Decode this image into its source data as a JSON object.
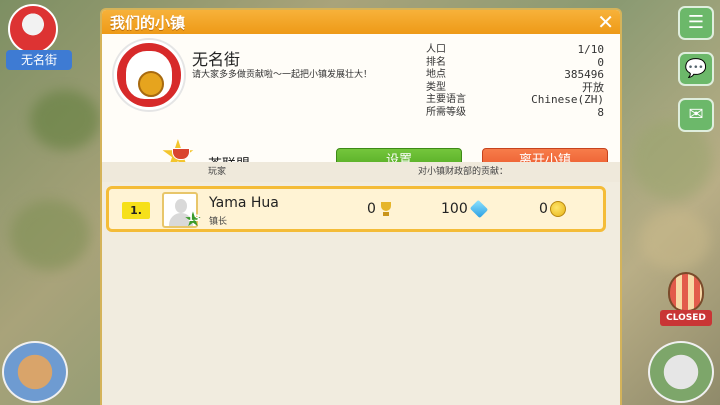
{
  "background": {
    "town_badge_label": "无名街"
  },
  "modal": {
    "title": "我们的小镇",
    "close_label": "✕"
  },
  "town": {
    "name": "无名街",
    "description": "请大家多多做贡献啦～一起把小镇发展壮大！",
    "stats": [
      {
        "label": "人口",
        "value": "1/10"
      },
      {
        "label": "排名",
        "value": "0"
      },
      {
        "label": "地点",
        "value": "385496"
      },
      {
        "label": "类型",
        "value": "开放"
      },
      {
        "label": "主要语言",
        "value": "Chinese(ZH)"
      },
      {
        "label": "所需等级",
        "value": "8"
      }
    ],
    "guild_name": "茶联盟"
  },
  "buttons": {
    "settings": "设置",
    "leave": "离开小镇"
  },
  "list": {
    "col_player": "玩家",
    "col_contribution": "对小镇财政部的贡献：",
    "rows": [
      {
        "rank": "1.",
        "level": "13",
        "name": "Yama Hua",
        "role": "镇长",
        "trophies": "0",
        "gems": "100",
        "coins": "0"
      }
    ]
  },
  "side": {
    "closed_label": "CLOSED"
  },
  "icons": {
    "menu": "list-icon",
    "chat": "chat-bubble-icon",
    "mail": "mail-icon"
  },
  "colors": {
    "header": "#ee9a17",
    "settings_button": "#4ea51f",
    "leave_button": "#e9562a",
    "row_border": "#f4bc38"
  }
}
